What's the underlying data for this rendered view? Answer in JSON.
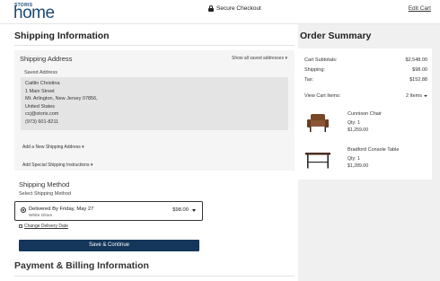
{
  "header": {
    "logo_small": "STORIS",
    "logo_big": "home",
    "secure_checkout": "Secure Checkout",
    "edit_cart": "Edit Cart"
  },
  "shipping": {
    "title": "Shipping Information",
    "address_title": "Shipping Address",
    "show_all": "Show all saved addresses",
    "saved_label": "Saved Address",
    "address_lines": [
      "Caitlin Christina",
      "1 Main Street",
      "Mt. Arlington, New Jersey 07856,",
      "United States",
      "ccj@storis.com",
      "(973) 601-8211"
    ],
    "add_new": "Add a New Shipping Address",
    "add_special": "Add Special Shipping Instructions"
  },
  "method": {
    "title": "Shipping Method",
    "select_label": "Select Shipping Method",
    "option_title": "Delivered By Friday, May 27",
    "option_sub": "White Glove",
    "option_price": "$98.00",
    "change_date": "Change Delivery Date"
  },
  "continue_button": "Save & Continue",
  "payment_title": "Payment & Billing Information",
  "order_summary": {
    "title": "Order Summary",
    "rows": [
      {
        "label": "Cart Subtotals:",
        "value": "$2,548.00"
      },
      {
        "label": "Shipping:",
        "value": "$98.00"
      },
      {
        "label": "Tax:",
        "value": "$152.88"
      }
    ],
    "view_items_label": "View Cart Items:",
    "items_count": "2 Items",
    "items": [
      {
        "name": "Cunnison Chair",
        "qty": "Qty: 1",
        "price": "$1,259.00",
        "icon": "armchair-icon"
      },
      {
        "name": "Bradford Console Table",
        "qty": "Qty: 1",
        "price": "$1,289.00",
        "icon": "console-table-icon"
      }
    ]
  },
  "colors": {
    "brand": "#1c4a75",
    "button": "#13365a",
    "summary_bg": "#f0f0f0",
    "panel_bg": "#f5f5f5"
  }
}
